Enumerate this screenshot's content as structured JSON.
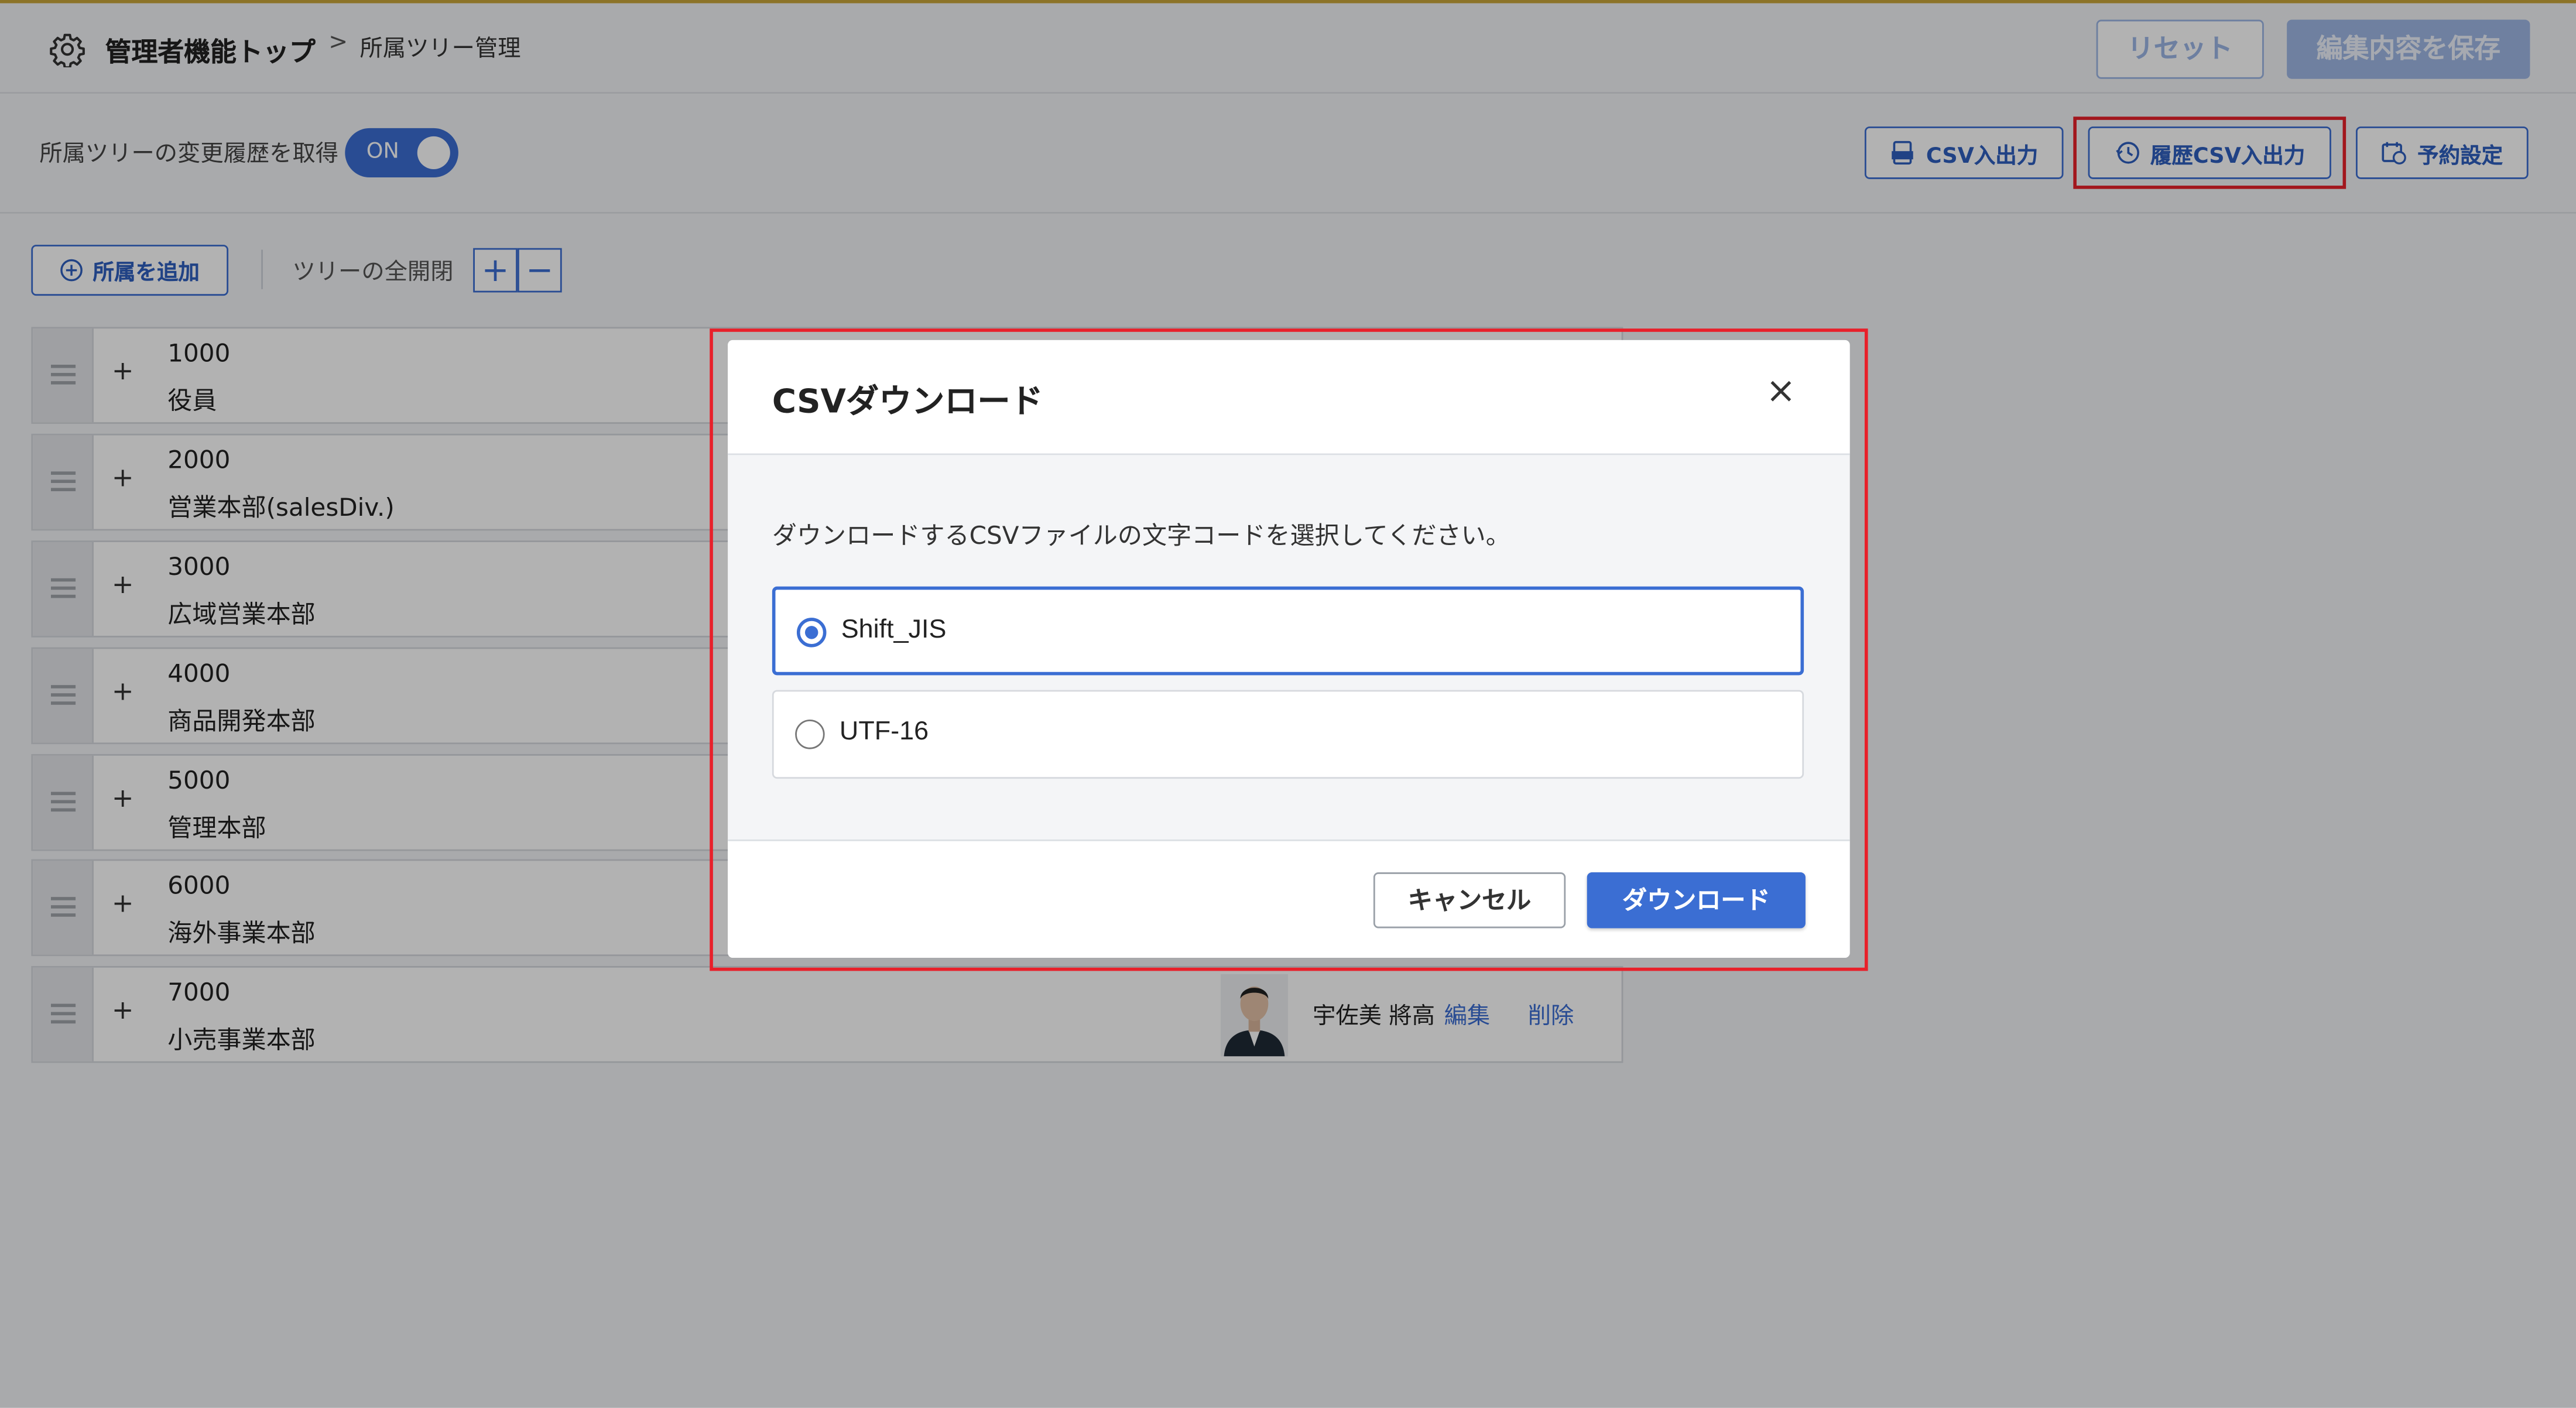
{
  "header": {
    "breadcrumb_home": "管理者機能トップ",
    "breadcrumb_separator": ">",
    "breadcrumb_current": "所属ツリー管理",
    "reset_label": "リセット",
    "save_label": "編集内容を保存"
  },
  "history": {
    "label": "所属ツリーの変更履歴を取得",
    "toggle_label": "ON"
  },
  "actions": {
    "csv_io": "CSV入出力",
    "history_csv_io": "履歴CSV入出力",
    "schedule": "予約設定"
  },
  "tree_toolbar": {
    "add_label": "所属を追加",
    "expand_all_label": "ツリーの全開閉",
    "expand_symbol": "+",
    "collapse_symbol": "−"
  },
  "tree_rows": [
    {
      "code": "1000",
      "name": "役員"
    },
    {
      "code": "2000",
      "name": "営業本部(salesDiv.)"
    },
    {
      "code": "3000",
      "name": "広域営業本部"
    },
    {
      "code": "4000",
      "name": "商品開発本部"
    },
    {
      "code": "5000",
      "name": "管理本部"
    },
    {
      "code": "6000",
      "name": "海外事業本部"
    },
    {
      "code": "7000",
      "name": "小売事業本部",
      "manager": "宇佐美 將高",
      "edit": "編集",
      "delete": "削除"
    }
  ],
  "modal": {
    "title": "CSVダウンロード",
    "close_symbol": "×",
    "description": "ダウンロードするCSVファイルの文字コードを選択してください。",
    "options": [
      {
        "label": "Shift_JIS",
        "selected": true
      },
      {
        "label": "UTF-16",
        "selected": false
      }
    ],
    "cancel_label": "キャンセル",
    "download_label": "ダウンロード"
  },
  "colors": {
    "accent": "#3b6ed3",
    "highlight": "#e8202a",
    "topline": "#c9a53a"
  }
}
